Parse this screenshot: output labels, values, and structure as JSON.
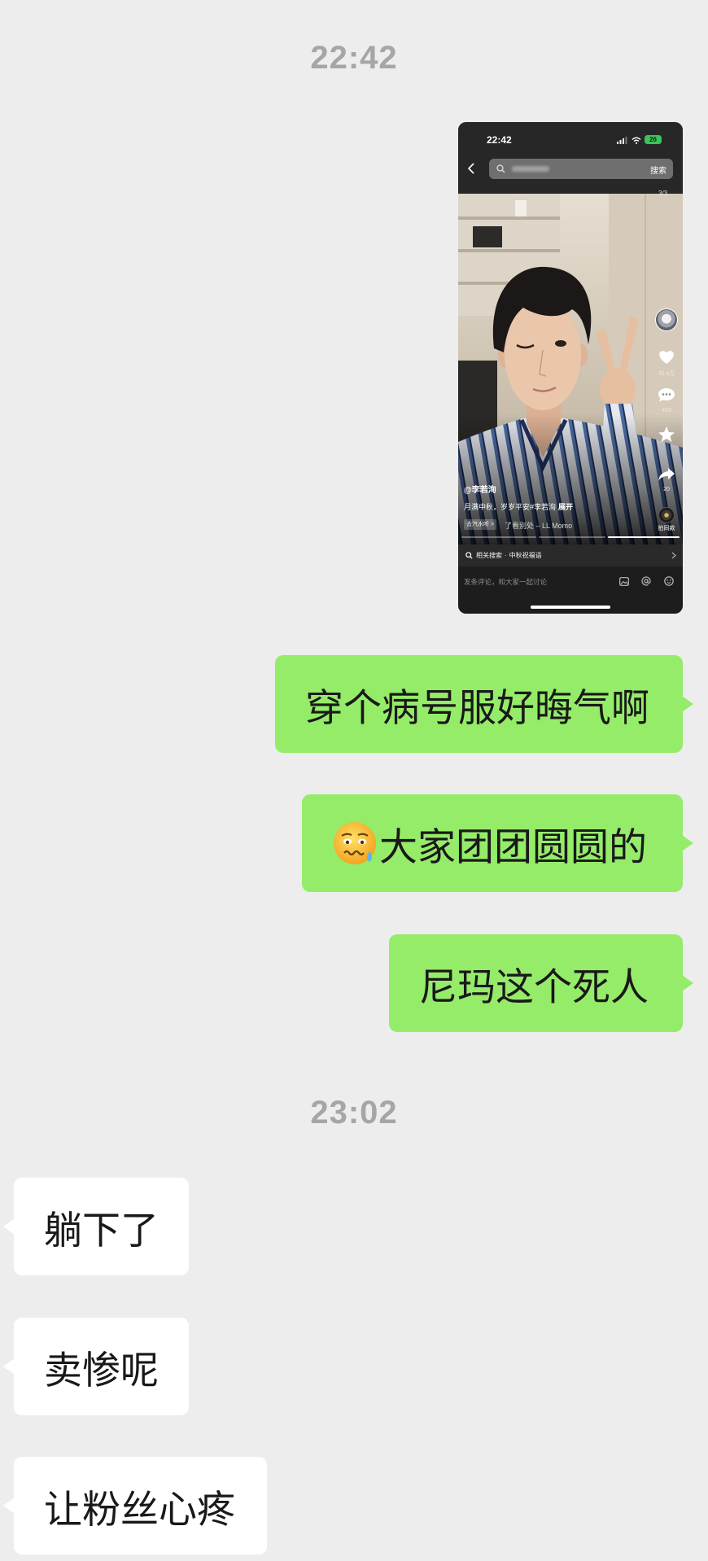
{
  "colors": {
    "page_background": "#EDEDED",
    "sent_bubble": "#95EC69",
    "received_bubble": "#FFFFFF",
    "timestamp_text": "#A6A6A6",
    "message_text": "#191919"
  },
  "sections": [
    {
      "timestamp": "22:42",
      "sent": [
        {
          "image": {
            "status_bar": {
              "time": "22:42",
              "battery": "26"
            },
            "search_bar": {
              "button": "搜索"
            },
            "page_indicator": "3/3",
            "side_actions": {
              "like_count": "45.4万",
              "comment_count": "493",
              "share_count": "20"
            },
            "author": "@李若洵",
            "caption": "月满中秋，岁岁平安#李若洵",
            "expand": "展开",
            "music_tag": "去汽水听 >",
            "music_title": "了看别处 – LL Momo",
            "same_style_button": "拍同款",
            "related_search": {
              "label": "相关搜索",
              "separator": "·",
              "query": "中秋祝福语"
            },
            "comment_placeholder": "发条评论，和大家一起讨论"
          }
        },
        {
          "text": "穿个病号服好晦气啊"
        },
        {
          "emoji": "woozy-face-with-tear-icon",
          "text": "大家团团圆圆的"
        },
        {
          "text": "尼玛这个死人"
        }
      ]
    },
    {
      "timestamp": "23:02",
      "received": [
        {
          "text": "躺下了"
        },
        {
          "text": "卖惨呢"
        },
        {
          "text": "让粉丝心疼"
        }
      ]
    }
  ]
}
